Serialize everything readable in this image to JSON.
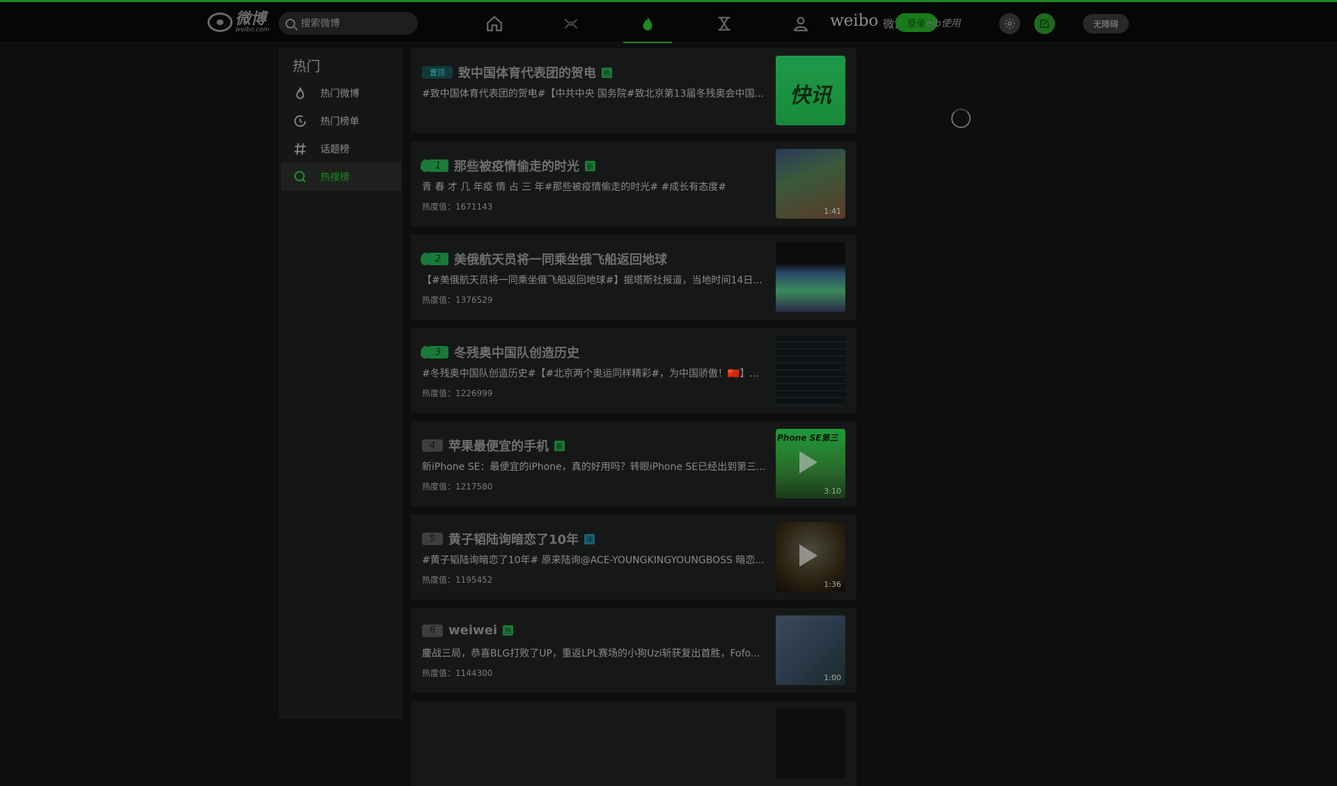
{
  "header": {
    "logo_zh": "微博",
    "logo_en": "weibo.com",
    "search_placeholder": "搜索微博",
    "brand": "weibo",
    "brand_zh": "微博",
    "login_label": "登录",
    "brand_tail": "eib使用",
    "barrier_label": "无障碍",
    "nav_icons": [
      "home-icon",
      "video-icon",
      "hot-icon",
      "ranking-icon",
      "profile-icon"
    ],
    "active_nav": 2
  },
  "sidebar": {
    "title": "热门",
    "items": [
      {
        "label": "热门微博",
        "icon": "flame-icon"
      },
      {
        "label": "热门榜单",
        "icon": "clock-icon"
      },
      {
        "label": "话题榜",
        "icon": "hash-icon"
      },
      {
        "label": "热搜榜",
        "icon": "search-circle-icon",
        "active": true
      }
    ]
  },
  "feed": [
    {
      "rank": "置顶",
      "title": "致中国体育代表团的贺电",
      "tag": "热",
      "desc": "#致中国体育代表团的贺电#【中共中央 国务院#致北京第13届冬残奥会中国...",
      "heat": "",
      "thumb_text": "快讯"
    },
    {
      "rank": "1",
      "title": "那些被疫情偷走的时光",
      "tag": "新",
      "desc": "青 春 才 几 年疫 情 占 三 年#那些被疫情偷走的时光# #成长有态度#",
      "heat": "热度值：1671143",
      "thumb_dur": "1:41"
    },
    {
      "rank": "2",
      "title": "美俄航天员将一同乘坐俄飞船返回地球",
      "tag": "",
      "desc": "【#美俄航天员将一同乘坐俄飞船返回地球#】据塔斯社报道，当地时间14日...",
      "heat": "热度值：1376529"
    },
    {
      "rank": "3",
      "title": "冬残奥中国队创造历史",
      "tag": "",
      "desc": "#冬残奥中国队创造历史#【#北京两个奥运同样精彩#，为中国骄傲！🇨🇳】...",
      "heat": "热度值：1226999"
    },
    {
      "rank": "4",
      "title": "苹果最便宜的手机",
      "tag": "新",
      "desc": "新iPhone SE：最便宜的iPhone，真的好用吗？转眼iPhone SE已经出到第三...",
      "heat": "热度值：1217580",
      "thumb_text": "Phone SE第三",
      "thumb_dur": "3:10"
    },
    {
      "rank": "5",
      "title": "黄子韬陆询暗恋了10年",
      "tag": "沸",
      "desc": "#黄子韬陆询暗恋了10年# 原来陆询@ACE-YOUNGKINGYOUNGBOSS 暗恋...",
      "heat": "热度值：1195452",
      "thumb_dur": "1:36"
    },
    {
      "rank": "6",
      "title": "weiwei",
      "tag": "热",
      "desc": "鏖战三局，恭喜BLG打败了UP，重返LPL赛场的小狗Uzi斩获复出首胜，Fofo...",
      "heat": "热度值：1144300",
      "thumb_dur": "1:00"
    }
  ]
}
